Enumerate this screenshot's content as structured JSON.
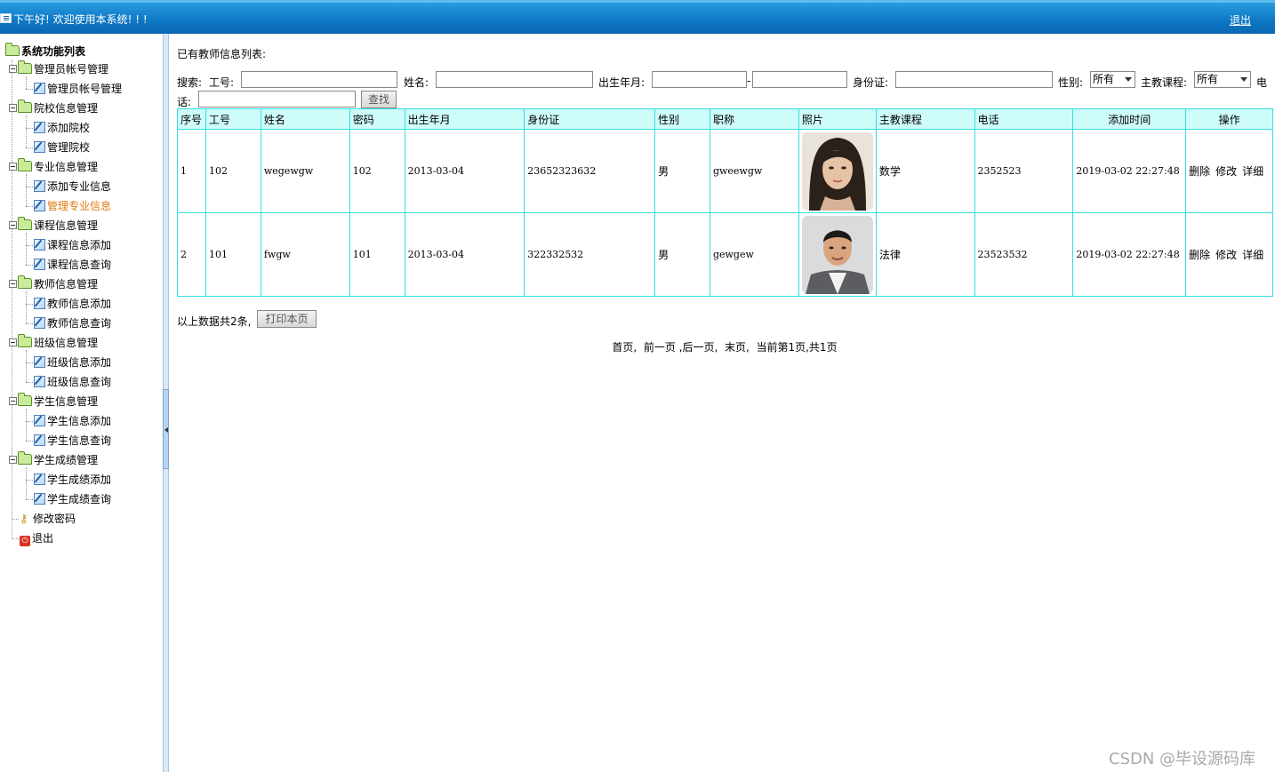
{
  "header": {
    "welcome": "下午好! 欢迎使用本系统! ! !",
    "logout": "退出"
  },
  "sidebar": {
    "root": "系统功能列表",
    "groups": [
      {
        "label": "管理员帐号管理",
        "items": [
          "管理员帐号管理"
        ]
      },
      {
        "label": "院校信息管理",
        "items": [
          "添加院校",
          "管理院校"
        ]
      },
      {
        "label": "专业信息管理",
        "items": [
          "添加专业信息",
          "管理专业信息"
        ]
      },
      {
        "label": "课程信息管理",
        "items": [
          "课程信息添加",
          "课程信息查询"
        ]
      },
      {
        "label": "教师信息管理",
        "items": [
          "教师信息添加",
          "教师信息查询"
        ]
      },
      {
        "label": "班级信息管理",
        "items": [
          "班级信息添加",
          "班级信息查询"
        ]
      },
      {
        "label": "学生信息管理",
        "items": [
          "学生信息添加",
          "学生信息查询"
        ]
      },
      {
        "label": "学生成绩管理",
        "items": [
          "学生成绩添加",
          "学生成绩查询"
        ]
      }
    ],
    "change_password": "修改密码",
    "exit": "退出",
    "active_item": "管理专业信息"
  },
  "main": {
    "list_title": "已有教师信息列表:",
    "search": {
      "prefix": "搜索:",
      "staff_no_label": "工号:",
      "name_label": "姓名:",
      "birth_label": "出生年月:",
      "range_sep": "-",
      "id_label": "身份证:",
      "gender_label": "性别:",
      "gender_value": "所有",
      "course_label": "主教课程:",
      "course_value": "所有",
      "phone_label_1": "电",
      "phone_label_2": "话:",
      "search_button": "查找"
    },
    "table": {
      "headers": [
        "序号",
        "工号",
        "姓名",
        "密码",
        "出生年月",
        "身份证",
        "性别",
        "职称",
        "照片",
        "主教课程",
        "电话",
        "添加时间",
        "操作"
      ],
      "rows": [
        {
          "no": "1",
          "staff_no": "102",
          "name": "wegewgw",
          "password": "102",
          "birth": "2013-03-04",
          "id_card": "23652323632",
          "gender": "男",
          "title": "gweewgw",
          "course": "数学",
          "phone": "2352523",
          "added": "2019-03-02 22:27:48"
        },
        {
          "no": "2",
          "staff_no": "101",
          "name": "fwgw",
          "password": "101",
          "birth": "2013-03-04",
          "id_card": "322332532",
          "gender": "男",
          "title": "gewgew",
          "course": "法律",
          "phone": "23523532",
          "added": "2019-03-02 22:27:48"
        }
      ],
      "ops": {
        "delete": "删除",
        "edit": "修改",
        "detail": "详细"
      }
    },
    "summary": "以上数据共2条,",
    "print_button": "打印本页",
    "pager": {
      "first": "首页,",
      "prev": "前一页",
      "next": ",后一页,",
      "last": "末页,",
      "status": "当前第1页,共1页"
    }
  },
  "watermark": "CSDN @毕设源码库",
  "colors": {
    "header_blue": "#0f79c6",
    "table_border": "#34dfdf",
    "table_header_bg": "#cefcfa",
    "active_orange": "#e07b12"
  }
}
